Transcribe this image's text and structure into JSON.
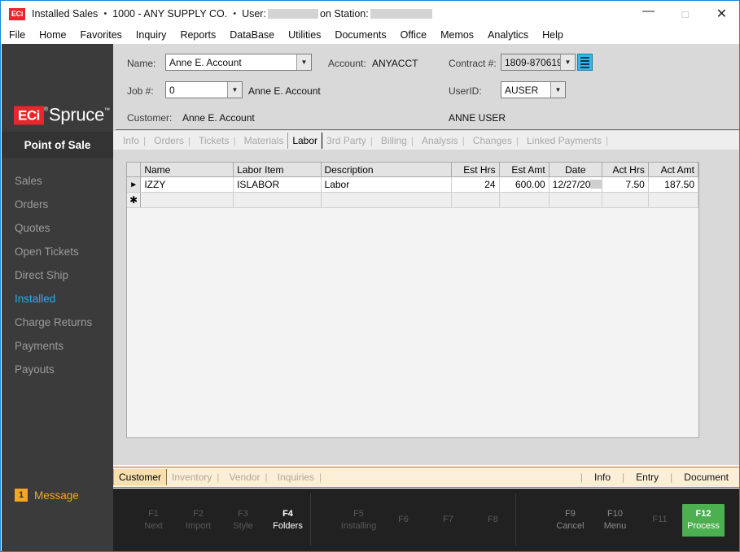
{
  "titlebar": {
    "app_icon": "eci-logo-icon",
    "app_badge": "ECi",
    "title": "Installed Sales",
    "company": "1000 - ANY SUPPLY CO.",
    "user_label": "User:",
    "station_label": "on Station:",
    "bullet": "•",
    "minimize": "—",
    "maximize": "□",
    "close": "✕"
  },
  "menubar": {
    "items": [
      "File",
      "Home",
      "Favorites",
      "Inquiry",
      "Reports",
      "DataBase",
      "Utilities",
      "Documents",
      "Office",
      "Memos",
      "Analytics",
      "Help"
    ]
  },
  "sidebar": {
    "logo": {
      "eci": "ECi",
      "reg": "®",
      "product": "Spruce",
      "tm": "™"
    },
    "title": "Point of Sale",
    "items": [
      {
        "label": "Sales",
        "active": false
      },
      {
        "label": "Orders",
        "active": false
      },
      {
        "label": "Quotes",
        "active": false
      },
      {
        "label": "Open Tickets",
        "active": false
      },
      {
        "label": "Direct Ship",
        "active": false
      },
      {
        "label": "Installed",
        "active": true
      },
      {
        "label": "Charge Returns",
        "active": false
      },
      {
        "label": "Payments",
        "active": false
      },
      {
        "label": "Payouts",
        "active": false
      }
    ],
    "message": {
      "count": "1",
      "label": "Message"
    },
    "colors": {
      "bg": "#3b3b3b",
      "active": "#2dace3",
      "message": "#f5a623"
    }
  },
  "header_form": {
    "name_label": "Name:",
    "name_value": "Anne E. Account",
    "account_label": "Account:",
    "account_value": "ANYACCT",
    "contract_label": "Contract #:",
    "contract_value": "1809-870619",
    "contract_list_icon": "list-lines-icon",
    "job_label": "Job #:",
    "job_value": "0",
    "job_name": "Anne E. Account",
    "userid_label": "UserID:",
    "userid_value": "AUSER",
    "username": "ANNE USER",
    "customer_label": "Customer:",
    "customer_value": "Anne E. Account",
    "dropdown_arrow": "▼"
  },
  "tabs": [
    {
      "label": "Info",
      "active": false
    },
    {
      "label": "Orders",
      "active": false
    },
    {
      "label": "Tickets",
      "active": false
    },
    {
      "label": "Materials",
      "active": false
    },
    {
      "label": "Labor",
      "active": true
    },
    {
      "label": "3rd Party",
      "active": false
    },
    {
      "label": "Billing",
      "active": false
    },
    {
      "label": "Analysis",
      "active": false
    },
    {
      "label": "Changes",
      "active": false
    },
    {
      "label": "Linked Payments",
      "active": false
    }
  ],
  "grid": {
    "columns": [
      {
        "label": "",
        "key": "sel",
        "align": "center"
      },
      {
        "label": "Name",
        "key": "name",
        "align": "left"
      },
      {
        "label": "Labor Item",
        "key": "labor_item",
        "align": "left"
      },
      {
        "label": "Description",
        "key": "description",
        "align": "left"
      },
      {
        "label": "Est Hrs",
        "key": "est_hrs",
        "align": "right"
      },
      {
        "label": "Est Amt",
        "key": "est_amt",
        "align": "right"
      },
      {
        "label": "Date",
        "key": "date",
        "align": "center"
      },
      {
        "label": "Act Hrs",
        "key": "act_hrs",
        "align": "right"
      },
      {
        "label": "Act Amt",
        "key": "act_amt",
        "align": "right"
      }
    ],
    "rows": [
      {
        "selector": "►",
        "name": "IZZY",
        "labor_item": "ISLABOR",
        "description": "Labor",
        "est_hrs": "24",
        "est_amt": "600.00",
        "date": "12/27/20",
        "date_redacted": true,
        "act_hrs": "7.50",
        "act_amt": "187.50"
      }
    ],
    "new_row_marker": "✱"
  },
  "creambar": {
    "tabs": [
      {
        "label": "Customer",
        "active": true
      },
      {
        "label": "Inventory",
        "active": false
      },
      {
        "label": "Vendor",
        "active": false
      },
      {
        "label": "Inquiries",
        "active": false
      }
    ],
    "right_links": [
      "Info",
      "Entry",
      "Document"
    ],
    "separator": "|"
  },
  "function_keys": {
    "groups": [
      [
        {
          "key": "F1",
          "label": "Next",
          "state": "dim"
        },
        {
          "key": "F2",
          "label": "Import",
          "state": "dim"
        },
        {
          "key": "F3",
          "label": "Style",
          "state": "dim"
        },
        {
          "key": "F4",
          "label": "Folders",
          "state": "lit"
        }
      ],
      [
        {
          "key": "F5",
          "label": "Installing",
          "state": "dim"
        },
        {
          "key": "F6",
          "label": "",
          "state": "dim"
        },
        {
          "key": "F7",
          "label": "",
          "state": "dim"
        },
        {
          "key": "F8",
          "label": "",
          "state": "dim"
        }
      ],
      [
        {
          "key": "F9",
          "label": "Cancel",
          "state": "semi"
        },
        {
          "key": "F10",
          "label": "Menu",
          "state": "semi"
        },
        {
          "key": "F11",
          "label": "",
          "state": "dim"
        },
        {
          "key": "F12",
          "label": "Process",
          "state": "green"
        }
      ]
    ],
    "accent_green": "#4caf50"
  }
}
